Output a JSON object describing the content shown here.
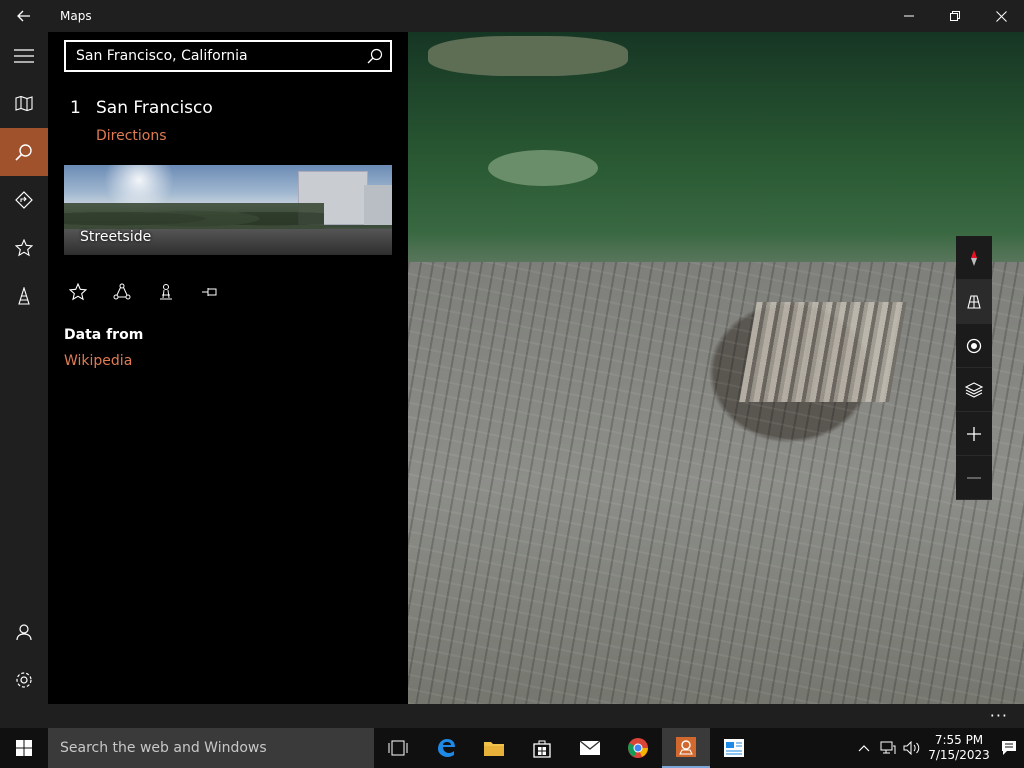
{
  "window": {
    "title": "Maps"
  },
  "search": {
    "value": "San Francisco, California"
  },
  "result": {
    "number": "1",
    "name": "San Francisco",
    "directions_label": "Directions",
    "streetside_label": "Streetside",
    "data_from_label": "Data from",
    "data_source_link": "Wikipedia"
  },
  "rail": {
    "items": [
      "menu-icon",
      "map-icon",
      "search-icon",
      "directions-icon",
      "favorites-icon",
      "landmarks-icon"
    ],
    "active": "search-icon",
    "bottom": [
      "account-icon",
      "settings-icon"
    ]
  },
  "actions": [
    "favorite-icon",
    "share-icon",
    "3d-landmark-icon",
    "pin-icon"
  ],
  "map_controls": [
    "compass-icon",
    "tilt-icon",
    "my-location-icon",
    "layers-icon",
    "zoom-in-icon",
    "zoom-out-icon"
  ],
  "appbar": {
    "more": "···"
  },
  "taskbar": {
    "search_placeholder": "Search the web and Windows",
    "time": "7:55 PM",
    "date": "7/15/2023"
  },
  "colors": {
    "accent": "#a0522d",
    "link": "#e07b54",
    "chrome": "#1f1f1f"
  }
}
